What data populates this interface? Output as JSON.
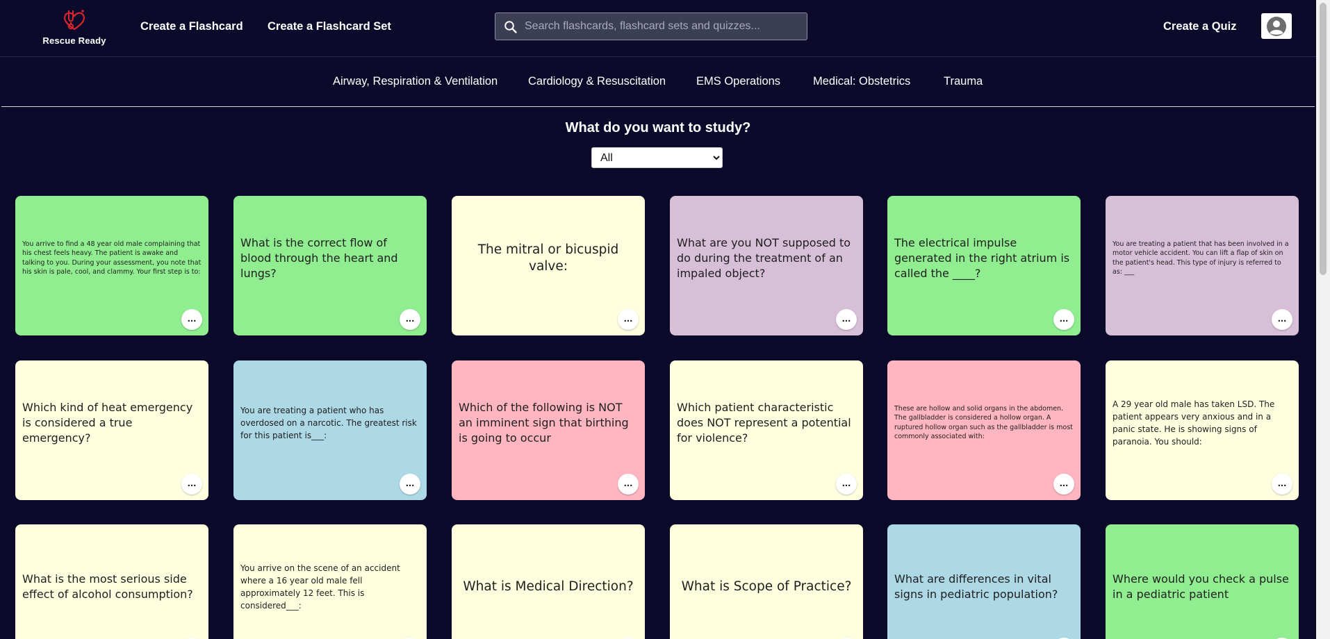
{
  "brand": {
    "name": "Rescue Ready",
    "accent": "#d7262e"
  },
  "nav": {
    "create_flashcard": "Create a Flashcard",
    "create_flashcard_set": "Create a Flashcard Set",
    "create_quiz": "Create a Quiz"
  },
  "search": {
    "placeholder": "Search flashcards, flashcard sets and quizzes...",
    "value": ""
  },
  "categories": [
    "Airway, Respiration & Ventilation",
    "Cardiology & Resuscitation",
    "EMS Operations",
    "Medical: Obstetrics",
    "Trauma"
  ],
  "study": {
    "title": "What do you want to study?",
    "selected": "All"
  },
  "more_label": "...",
  "colors": {
    "background": "#0b0a2a",
    "green": "#90ee90",
    "yellow": "#ffffe0",
    "purple": "#d8bfd8",
    "blue": "#add8e6",
    "pink": "#ffb6c1"
  },
  "cards": [
    {
      "text": "You arrive to find a 48 year old male complaining that his chest feels heavy. The patient is awake and talking to you. During your assessment, you note that his skin is pale, cool, and clammy. Your first step is to:",
      "color": "green"
    },
    {
      "text": "What is the correct flow of blood through the heart and lungs?",
      "color": "green"
    },
    {
      "text": "The mitral or bicuspid valve:",
      "color": "yellow"
    },
    {
      "text": "What are you NOT supposed to do during the treatment of an impaled object?",
      "color": "purple"
    },
    {
      "text": "The electrical impulse generated in the right atrium is called the ____?",
      "color": "green"
    },
    {
      "text": "You are treating a patient that has been involved in a motor vehicle accident. You can lift a flap of skin on the patient's head. This type of injury is referred to as: ___",
      "color": "purple"
    },
    {
      "text": "Which kind of heat emergency is considered a true emergency?",
      "color": "yellow"
    },
    {
      "text": "You are treating a patient who has overdosed on a narcotic. The greatest risk for this patient is___:",
      "color": "blue"
    },
    {
      "text": "Which of the following is NOT an imminent sign that birthing is going to occur",
      "color": "pink"
    },
    {
      "text": "Which patient characteristic does NOT represent a potential for violence?",
      "color": "yellow"
    },
    {
      "text": "These are hollow and solid organs in the abdomen. The gallbladder is considered a hollow organ. A ruptured hollow organ such as the gallbladder is most commonly associated with:",
      "color": "pink"
    },
    {
      "text": "A 29 year old male has taken LSD. The patient appears very anxious and in a panic state. He is showing signs of paranoia. You should:",
      "color": "yellow"
    },
    {
      "text": "What is the most serious side effect of alcohol consumption?",
      "color": "yellow"
    },
    {
      "text": "You arrive on the scene of an accident where a 16 year old male fell approximately 12 feet. This is considered___:",
      "color": "yellow"
    },
    {
      "text": "What is Medical Direction?",
      "color": "yellow"
    },
    {
      "text": "What is Scope of Practice?",
      "color": "yellow"
    },
    {
      "text": "What are differences in vital signs in pediatric population?",
      "color": "blue"
    },
    {
      "text": "Where would you check a pulse in a pediatric patient",
      "color": "green"
    }
  ]
}
